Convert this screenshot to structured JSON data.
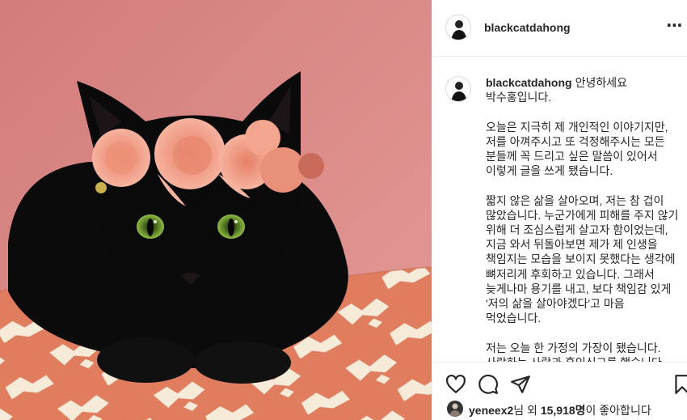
{
  "post": {
    "username": "blackcatdahong",
    "more_icon": "more-horizontal-icon",
    "caption": "안녕하세요 박수홍입니다.\n\n오늘은 지극히 제 개인적인 이야기지만, 저를 아껴주시고 또 걱정해주시는 모든 분들께 꼭 드리고 싶은 말씀이 있어서 이렇게 글을 쓰게 됐습니다.\n\n짧지 않은 삶을 살아오며, 저는 참 겁이 많았습니다. 누군가에게 피해를 주지 않기 위해 더 조심스럽게 살고자 함이었는데, 지금 와서 뒤돌아보면 제가 제 인생을 책임지는 모습을 보이지 못했다는 생각에 뼈저리게 후회하고 있습니다. 그래서 늦게나마 용기를 내고, 보다 책임감 있게 '저의 삶을 살아야겠다'고 마음 먹었습니다.\n\n저는 오늘 한 가정의 가장이 됐습니다.\n사랑하는 사람과 혼인신고를 했습니다",
    "photo_alt": "black cat wearing a peach flower crown on a patterned cushion"
  },
  "actions": {
    "like": "heart-icon",
    "comment": "comment-icon",
    "share": "send-icon",
    "save": "bookmark-icon"
  },
  "likes": {
    "first_liker": "yeneex2",
    "middle": "님 외 ",
    "count": "15,918명",
    "suffix": "이 좋아합니다"
  },
  "colors": {
    "wall": "#d98482",
    "cushion_orange": "#e07d5e",
    "cushion_cream": "#f6ead8",
    "flowers": "#f2a08a",
    "eyes": "#7fae3a"
  }
}
